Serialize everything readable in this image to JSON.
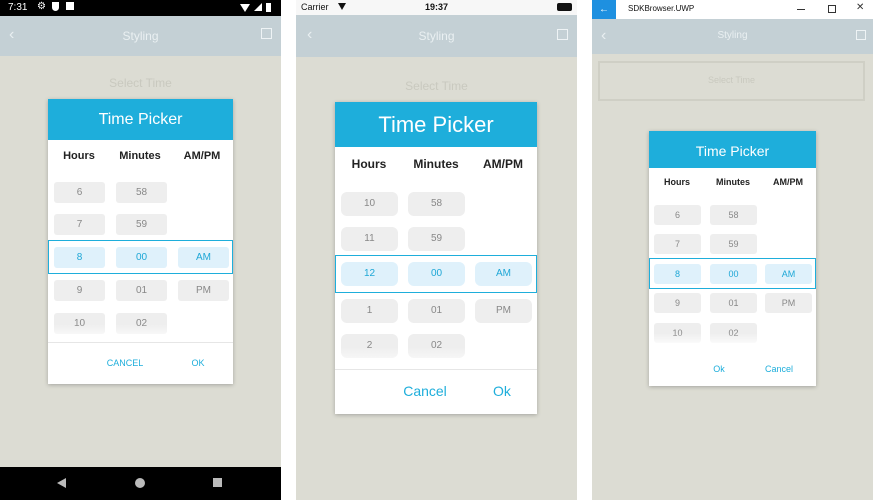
{
  "android": {
    "status": {
      "time": "7:31"
    },
    "nav_title": "Styling",
    "select_time": "Select Time",
    "dialog": {
      "title": "Time Picker",
      "headers": [
        "Hours",
        "Minutes",
        "AM/PM"
      ],
      "hours": [
        "6",
        "7",
        "8",
        "9",
        "10"
      ],
      "minutes": [
        "58",
        "59",
        "00",
        "01",
        "02"
      ],
      "ampm": [
        "AM",
        "PM"
      ],
      "cancel": "CANCEL",
      "ok": "OK"
    }
  },
  "ios": {
    "status": {
      "carrier": "Carrier",
      "time": "19:37"
    },
    "nav_title": "Styling",
    "select_time": "Select Time",
    "dialog": {
      "title": "Time Picker",
      "headers": [
        "Hours",
        "Minutes",
        "AM/PM"
      ],
      "hours": [
        "10",
        "11",
        "12",
        "1",
        "2"
      ],
      "minutes": [
        "58",
        "59",
        "00",
        "01",
        "02"
      ],
      "ampm": [
        "AM",
        "PM"
      ],
      "cancel": "Cancel",
      "ok": "Ok"
    }
  },
  "uwp": {
    "window_title": "SDKBrowser.UWP",
    "nav_title": "Styling",
    "select_time": "Select Time",
    "dialog": {
      "title": "Time Picker",
      "headers": [
        "Hours",
        "Minutes",
        "AM/PM"
      ],
      "hours": [
        "6",
        "7",
        "8",
        "9",
        "10"
      ],
      "minutes": [
        "58",
        "59",
        "00",
        "01",
        "02"
      ],
      "ampm": [
        "AM",
        "PM"
      ],
      "ok": "Ok",
      "cancel": "Cancel"
    }
  },
  "colors": {
    "accent": "#1eaedb",
    "backdrop": "#dcdcd3",
    "nav": "#c4d0d5"
  }
}
